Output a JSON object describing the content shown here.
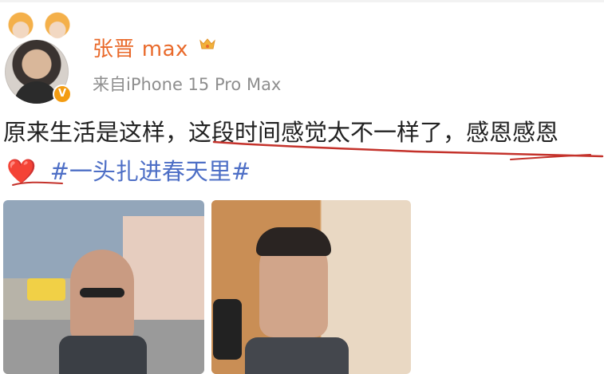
{
  "post": {
    "username": "张晋 max",
    "source": "来自iPhone 15 Pro Max",
    "text_main": "原来生活是这样，这段时间感觉太不一样了，感恩感恩",
    "heart_emoji": "❤️",
    "topic": "#一头扎进春天里#"
  },
  "icons": {
    "avatar_badge": "verified-v-icon",
    "crown": "crown-icon",
    "avatar_decorations": "ox-hat-icons"
  },
  "colors": {
    "username": "#e96a2b",
    "source": "#8e8e8e",
    "topic": "#4e6fc6",
    "heart": "#e02424",
    "annotation_red": "#c4322b"
  },
  "photos": [
    {
      "label": "selfie-street"
    },
    {
      "label": "selfie-mirror"
    }
  ]
}
